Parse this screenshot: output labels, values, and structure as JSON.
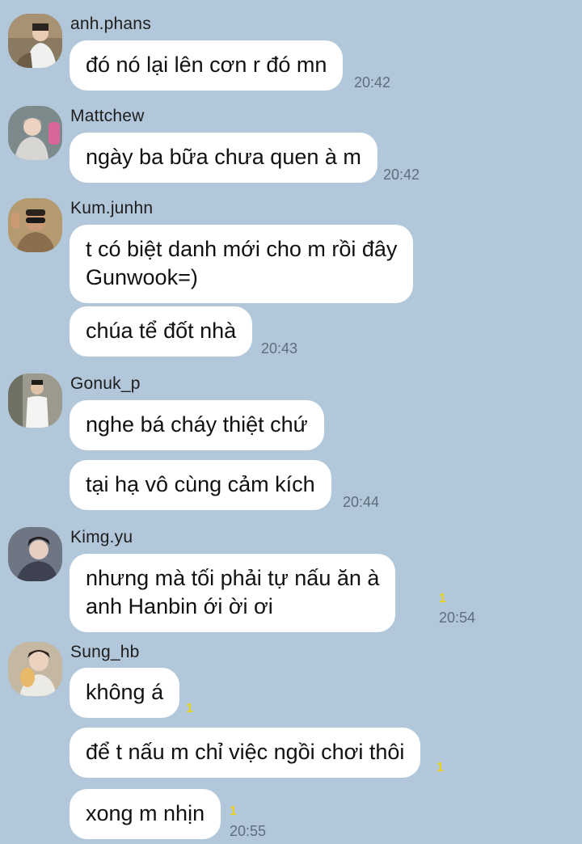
{
  "colors": {
    "background": "#b2c7d9",
    "bubble": "#ffffff",
    "unread": "#e8d21e"
  },
  "groups": [
    {
      "sender": "anh.phans",
      "avatar_icon": "user-avatar-photo",
      "messages": [
        {
          "text": "đó nó lại lên cơn r đó mn",
          "time": "20:42",
          "unread": ""
        }
      ]
    },
    {
      "sender": "Mattchew",
      "avatar_icon": "user-avatar-photo",
      "messages": [
        {
          "text": "ngày ba bữa chưa quen à m",
          "time": "20:42",
          "unread": ""
        }
      ]
    },
    {
      "sender": "Kum.junhn",
      "avatar_icon": "user-avatar-photo",
      "messages": [
        {
          "line1": "t có biệt danh mới cho m rồi đây",
          "line2": "Gunwook=)",
          "time": "",
          "unread": ""
        },
        {
          "text": "chúa tể đốt nhà",
          "time": "20:43",
          "unread": ""
        }
      ]
    },
    {
      "sender": "Gonuk_p",
      "avatar_icon": "user-avatar-photo",
      "messages": [
        {
          "text": "nghe bá cháy thiệt chứ",
          "time": "",
          "unread": ""
        },
        {
          "text": "tại hạ vô cùng cảm kích",
          "time": "20:44",
          "unread": ""
        }
      ]
    },
    {
      "sender": "Kimg.yu",
      "avatar_icon": "user-avatar-photo",
      "messages": [
        {
          "line1": "nhưng mà tối phải tự nấu ăn à",
          "line2": "anh Hanbin ới ời ơi",
          "time": "20:54",
          "unread": "1"
        }
      ]
    },
    {
      "sender": "Sung_hb",
      "avatar_icon": "user-avatar-photo",
      "messages": [
        {
          "text": "không á",
          "time": "",
          "unread": "1"
        },
        {
          "text": "để t nấu m chỉ việc ngồi chơi thôi",
          "time": "",
          "unread": "1"
        },
        {
          "text": "xong m nhịn",
          "time": "20:55",
          "unread": "1"
        }
      ]
    }
  ]
}
